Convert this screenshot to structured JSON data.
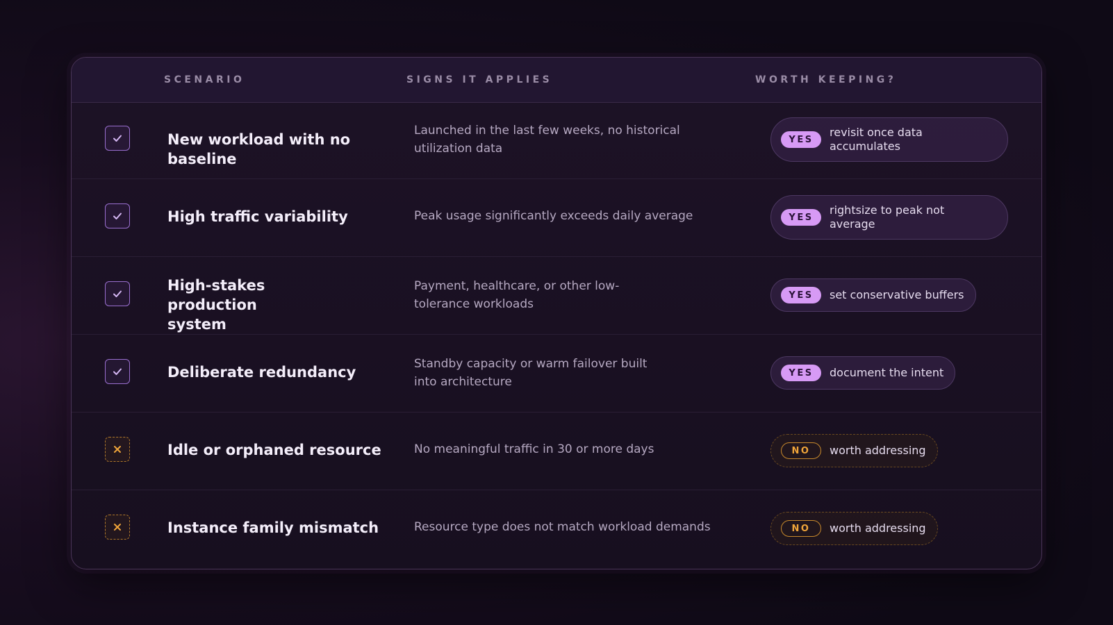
{
  "headers": {
    "scenario": "SCENARIO",
    "signs": "SIGNS IT APPLIES",
    "worth": "WORTH KEEPING?"
  },
  "rows": [
    {
      "scenario": "New workload with no baseline",
      "signs": "Launched in the last few weeks, no historical utilization data",
      "verdict": "YES",
      "note": "revisit once data accumulates",
      "status": "yes"
    },
    {
      "scenario": "High traffic variability",
      "signs": "Peak usage significantly exceeds daily average",
      "verdict": "YES",
      "note": "rightsize to peak not average",
      "status": "yes"
    },
    {
      "scenario": "High-stakes production system",
      "signs": "Payment, healthcare, or other low-tolerance workloads",
      "verdict": "YES",
      "note": "set conservative buffers",
      "status": "yes"
    },
    {
      "scenario": "Deliberate redundancy",
      "signs": "Standby capacity or warm failover built into architecture",
      "verdict": "YES",
      "note": "document the intent",
      "status": "yes"
    },
    {
      "scenario": "Idle or orphaned resource",
      "signs": "No meaningful traffic in 30 or more days",
      "verdict": "NO",
      "note": "worth addressing",
      "status": "no"
    },
    {
      "scenario": "Instance family mismatch",
      "signs": "Resource type does not match workload demands",
      "verdict": "NO",
      "note": "worth addressing",
      "status": "no"
    }
  ],
  "colors": {
    "yes_accent": "#d79af5",
    "no_accent": "#f0a53a"
  },
  "icons": {
    "yes": "check-icon",
    "no": "x-icon"
  }
}
